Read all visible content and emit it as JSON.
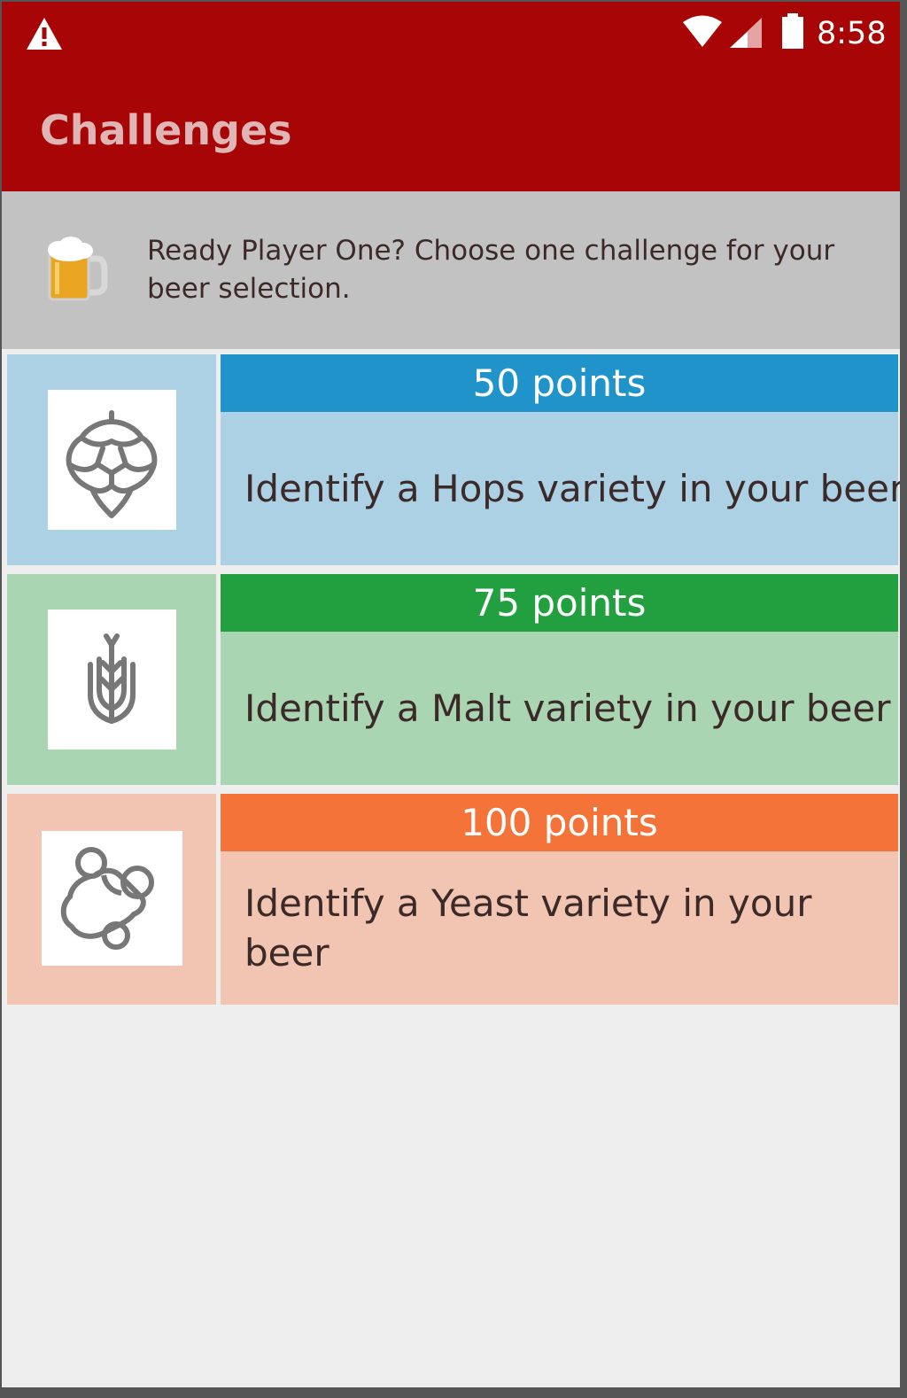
{
  "status_bar": {
    "time": "8:58",
    "icons": [
      "warning-icon",
      "wifi-icon",
      "cell-signal-icon",
      "battery-icon"
    ]
  },
  "toolbar": {
    "title": "Challenges"
  },
  "intro": {
    "icon": "beer-mug-icon",
    "text": "Ready Player One?  Choose one challenge for your beer selection."
  },
  "challenges": [
    {
      "icon": "hops-icon",
      "points": "50 points",
      "description": "Identify a Hops variety in your beer",
      "header_color": "#2193cb",
      "panel_color": "#acd0e4"
    },
    {
      "icon": "wheat-icon",
      "points": "75 points",
      "description": "Identify a Malt variety in your beer",
      "header_color": "#22a040",
      "panel_color": "#aad5b2"
    },
    {
      "icon": "yeast-icon",
      "points": "100 points",
      "description": "Identify a Yeast variety in your beer",
      "header_color": "#f37338",
      "panel_color": "#f1c5b2"
    }
  ],
  "colors": {
    "app_bar": "#a80606",
    "intro_bg": "#c2c2c2",
    "screen_bg": "#eeeeee",
    "text": "#3b2a28"
  }
}
